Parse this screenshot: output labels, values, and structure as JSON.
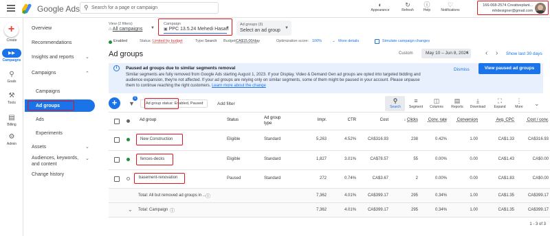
{
  "header": {
    "brand": "Google Ads",
    "search_placeholder": "Search for a page or campaign",
    "tools": [
      {
        "label": "Appearance",
        "icon": "appearance-icon"
      },
      {
        "label": "Refresh",
        "icon": "refresh-icon"
      },
      {
        "label": "Help",
        "icon": "help-icon"
      },
      {
        "label": "Notifications",
        "icon": "notifications-icon"
      }
    ],
    "account_line1": "166-068-2574 Creativeplant...",
    "account_line2": "mhdesigner@gmail.com"
  },
  "rail": {
    "create": "Create",
    "items": [
      {
        "label": "Campaigns",
        "icon": "campaigns-icon"
      },
      {
        "label": "Goals",
        "icon": "goals-icon"
      },
      {
        "label": "Tools",
        "icon": "tools-icon"
      },
      {
        "label": "Billing",
        "icon": "billing-icon"
      },
      {
        "label": "Admin",
        "icon": "admin-icon"
      }
    ]
  },
  "nav": {
    "overview": "Overview",
    "recommendations": "Recommendations",
    "insights": "Insights and reports",
    "campaigns_group": "Campaigns",
    "campaigns": "Campaigns",
    "ad_groups": "Ad groups",
    "ads": "Ads",
    "experiments": "Experiments",
    "assets": "Assets",
    "audiences": "Audiences, keywords, and content",
    "change_history": "Change history"
  },
  "selectors": {
    "view_label": "View (2 filters)",
    "view_value": "All campaigns",
    "campaign_label": "Campaign",
    "campaign_value": "PPC 13.5.24 Mehedi Hasan",
    "adgroups_label": "Ad groups (3)",
    "adgroups_value": "Select an ad group"
  },
  "status_bar": {
    "enabled": "Enabled",
    "status_prefix": "Status:",
    "status_value": "Limited by budget",
    "type_prefix": "Type:",
    "type_value": "Search",
    "budget_prefix": "Budget:",
    "budget_value": "CA$15.00/day",
    "opt_prefix": "Optimization score:",
    "opt_value": "100%",
    "more_details": "More details",
    "simulate": "Simulate campaign changes"
  },
  "page": {
    "title": "Ad groups",
    "custom_label": "Custom",
    "date_range": "May 10 – Jun 8, 2024",
    "show_last": "Show last 30 days"
  },
  "banner": {
    "title": "Paused ad groups due to similar segments removal",
    "body": "Similar segments are fully removed from Google Ads starting August 1, 2023. If your Display, Video & Demand Gen ad groups are opted into targeted bidding and audience expansion, they're not affected. If your ad groups are relying only on similar segments, some of them might be paused in your account. Please unpause them to continue reaching the right customers.",
    "learn_more": "Learn more about the change",
    "dismiss": "Dismiss",
    "view_paused": "View paused ad groups"
  },
  "filter": {
    "chip": "Ad group status: Enabled, Paused",
    "add_filter": "Add filter",
    "badge": "1"
  },
  "toolbar": [
    {
      "label": "Search",
      "icon": "search-icon"
    },
    {
      "label": "Segment",
      "icon": "segment-icon"
    },
    {
      "label": "Columns",
      "icon": "columns-icon"
    },
    {
      "label": "Reports",
      "icon": "reports-icon"
    },
    {
      "label": "Download",
      "icon": "download-icon"
    },
    {
      "label": "Expand",
      "icon": "expand-icon"
    },
    {
      "label": "More",
      "icon": "more-icon"
    }
  ],
  "table": {
    "headers": {
      "ad_group": "Ad group",
      "status": "Status",
      "type": "Ad group type",
      "impr": "Impr.",
      "ctr": "CTR",
      "cost": "Cost",
      "clicks": "Clicks",
      "conv_rate": "Conv. rate",
      "conversions": "Conversion",
      "avg_cpc": "Avg. CPC",
      "cost_conv": "Cost / conv."
    },
    "rows": [
      {
        "name": "New Construction",
        "status": "Eligible",
        "type": "Standard",
        "impr": "5,263",
        "ctr": "4.52%",
        "cost": "CA$316.93",
        "clicks": "238",
        "conv_rate": "0.42%",
        "conversions": "1.00",
        "avg_cpc": "CA$1.33",
        "cost_conv": "CA$316.93",
        "dot": "#1e8e3e"
      },
      {
        "name": "fences-decks",
        "status": "Eligible",
        "type": "Standard",
        "impr": "1,827",
        "ctr": "3.01%",
        "cost": "CA$78.57",
        "clicks": "55",
        "conv_rate": "0.00%",
        "conversions": "0.00",
        "avg_cpc": "CA$1.43",
        "cost_conv": "CA$0.00",
        "dot": "#1e8e3e"
      },
      {
        "name": "basement-renovation",
        "status": "Paused",
        "type": "Standard",
        "impr": "272",
        "ctr": "0.74%",
        "cost": "CA$3.67",
        "clicks": "2",
        "conv_rate": "0.00%",
        "conversions": "0.00",
        "avg_cpc": "CA$1.83",
        "cost_conv": "CA$0.00",
        "dot": "#80868b"
      }
    ],
    "total_removed": {
      "label": "Total: All but removed ad groups in ...",
      "impr": "7,362",
      "ctr": "4.01%",
      "cost": "CA$399.17",
      "clicks": "295",
      "conv_rate": "0.34%",
      "conversions": "1.00",
      "avg_cpc": "CA$1.35",
      "cost_conv": "CA$399.17"
    },
    "total_campaign": {
      "label": "Total: Campaign",
      "impr": "7,362",
      "ctr": "4.01%",
      "cost": "CA$399.17",
      "clicks": "295",
      "conv_rate": "0.34%",
      "conversions": "1.00",
      "avg_cpc": "CA$1.35",
      "cost_conv": "CA$399.17"
    },
    "pagination": "1 - 3 of 3"
  },
  "colors": {
    "accent": "#1a73e8",
    "highlight": "#e0141e",
    "banner_bg": "#e8f0fe",
    "nav_active": "#1a73e8"
  }
}
